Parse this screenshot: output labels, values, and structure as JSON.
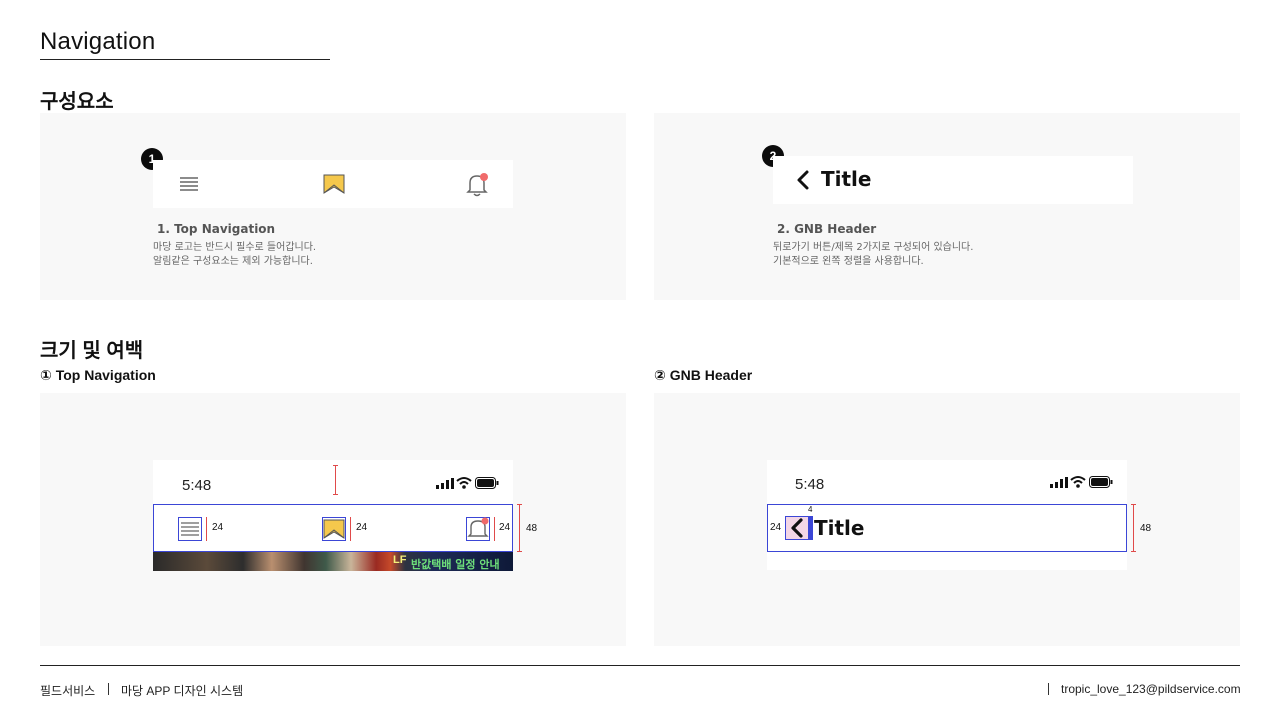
{
  "page": {
    "title": "Navigation"
  },
  "sections": {
    "components": "구성요소",
    "size_spacing": "크기 및 여백",
    "top_nav_sub": "① Top Navigation",
    "gnb_sub": "② GNB Header"
  },
  "card1": {
    "badge": "1",
    "caption_title": "1. Top Navigation",
    "caption_line1": "마당 로고는 반드시 필수로 들어갑니다.",
    "caption_line2": "알림같은 구성요소는 제외 가능합니다."
  },
  "card2": {
    "badge": "2",
    "header_title": "Title",
    "caption_title": "2. GNB Header",
    "caption_line1": "뒤로가기 버튼/제목 2가지로 구성되어 있습니다.",
    "caption_line2": "기본적으로 왼쪽 정렬을 사용합니다."
  },
  "spec1": {
    "time": "5:48",
    "icon_sizes": [
      "24",
      "24",
      "24"
    ],
    "bar_height": "48",
    "photo_text_1": "반값택배 일정 안내",
    "photo_text_2": "LF"
  },
  "spec2": {
    "time": "5:48",
    "left_padding": "24",
    "gap": "4",
    "header_title": "Title",
    "bar_height": "48"
  },
  "footer": {
    "company": "필드서비스",
    "system": "마당 APP 디자인 시스템",
    "email": "tropic_love_123@pildservice.com"
  },
  "colors": {
    "outline": "#3b46d6",
    "dimension": "#e04a4a",
    "notification_dot": "#f06b6b",
    "logo_yellow": "#f5c84c",
    "panel_bg": "#f8f8f8"
  },
  "icons": [
    "menu-icon",
    "madang-logo-icon",
    "bell-icon",
    "back-chevron-icon",
    "signal-icon",
    "wifi-icon",
    "battery-icon"
  ]
}
